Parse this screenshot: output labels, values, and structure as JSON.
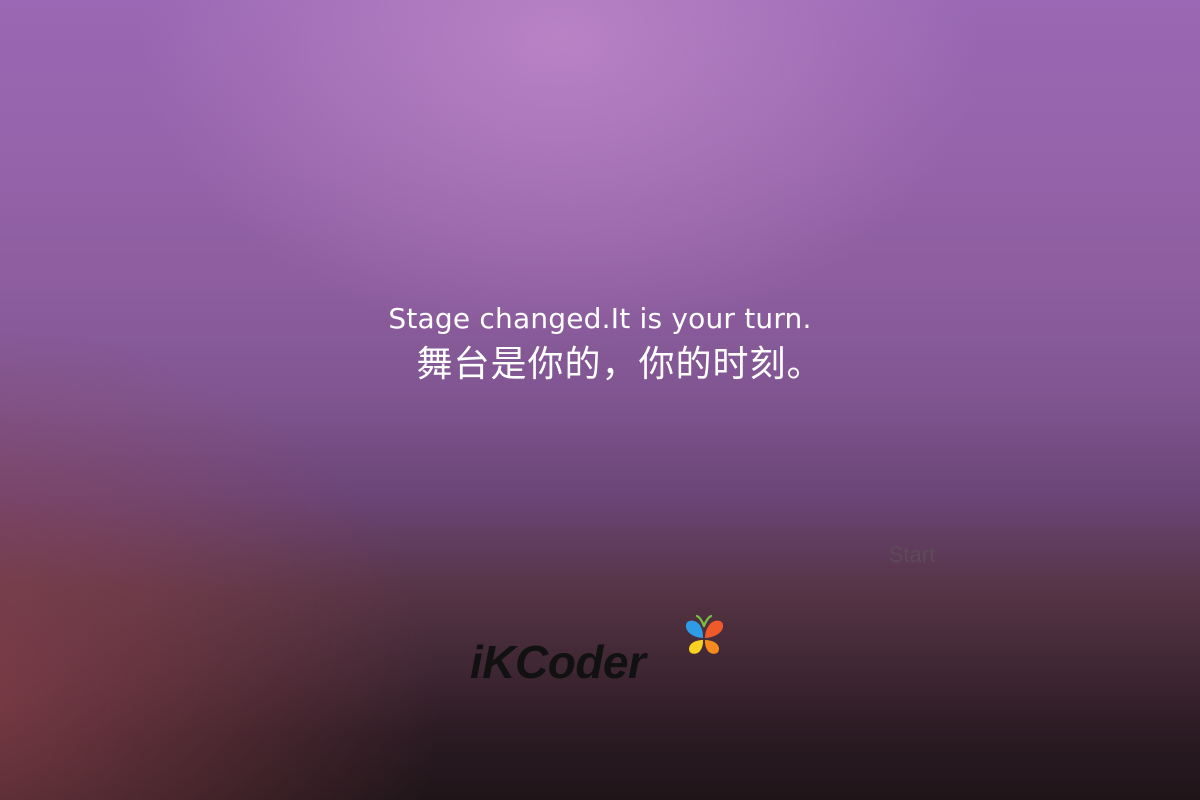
{
  "message": {
    "english": "Stage changed.It is your turn.",
    "chinese": "舞台是你的，你的时刻。"
  },
  "actions": {
    "start_label": "Start"
  },
  "branding": {
    "logo_text": "iKCoder",
    "logo_icon": "butterfly-icon",
    "logo_colors": [
      "#2e9be6",
      "#f05a28",
      "#f7d21e",
      "#f58a1f",
      "#7ac143"
    ]
  },
  "theme": {
    "text_color": "#ffffff",
    "start_text_color": "#5d4b5a"
  }
}
